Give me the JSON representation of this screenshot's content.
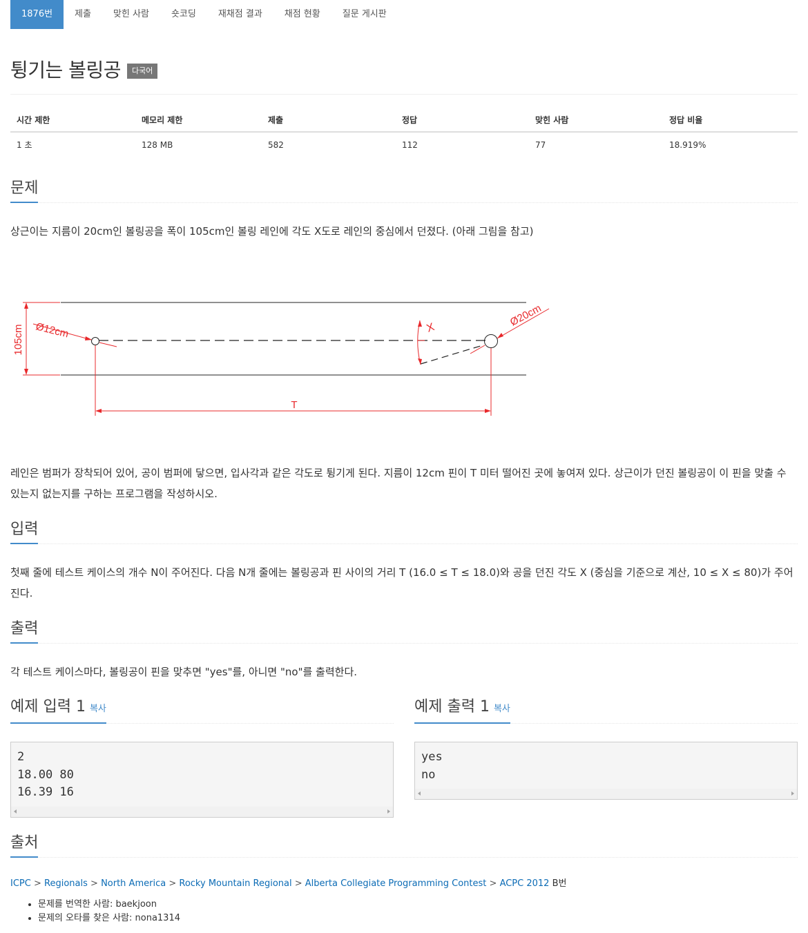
{
  "nav": {
    "tabs": [
      {
        "label": "1876번",
        "active": true
      },
      {
        "label": "제출"
      },
      {
        "label": "맞힌 사람"
      },
      {
        "label": "숏코딩"
      },
      {
        "label": "재채점 결과"
      },
      {
        "label": "채점 현황"
      },
      {
        "label": "질문 게시판"
      }
    ]
  },
  "problem": {
    "title": "튕기는 볼링공",
    "badge": "다국어"
  },
  "stats": {
    "headers": [
      "시간 제한",
      "메모리 제한",
      "제출",
      "정답",
      "맞힌 사람",
      "정답 비율"
    ],
    "values": [
      "1 초",
      "128 MB",
      "582",
      "112",
      "77",
      "18.919%"
    ]
  },
  "sections": {
    "description": {
      "heading": "문제",
      "text1": "상근이는 지름이 20cm인 볼링공을 폭이 105cm인 볼링 레인에 각도 X도로 레인의 중심에서 던졌다. (아래 그림을 참고)",
      "text2": "레인은 범퍼가 장착되어 있어, 공이 범퍼에 닿으면, 입사각과 같은 각도로 튕기게 된다. 지름이 12cm 핀이 T 미터 떨어진 곳에 놓여져 있다. 상근이가 던진 볼링공이 이 핀을 맞출 수 있는지 없는지를 구하는 프로그램을 작성하시오."
    },
    "input": {
      "heading": "입력",
      "text": "첫째 줄에 테스트 케이스의 개수 N이 주어진다. 다음 N개 줄에는 볼링공과 핀 사이의 거리 T (16.0 ≤ T ≤ 18.0)와 공을 던진 각도 X (중심을 기준으로 계산, 10 ≤ X ≤ 80)가 주어진다."
    },
    "output": {
      "heading": "출력",
      "text": "각 테스트 케이스마다, 볼링공이 핀을 맞추면 \"yes\"를, 아니면 \"no\"를 출력한다."
    },
    "sample_input": {
      "heading": "예제 입력 1",
      "copy_label": "복사",
      "lines": [
        "2",
        "18.00 80",
        "16.39 16"
      ]
    },
    "sample_output": {
      "heading": "예제 출력 1",
      "copy_label": "복사",
      "lines": [
        "yes",
        "no"
      ]
    },
    "source": {
      "heading": "출처",
      "breadcrumb": [
        "ICPC",
        "Regionals",
        "North America",
        "Rocky Mountain Regional",
        "Alberta Collegiate Programming Contest",
        "ACPC 2012"
      ],
      "suffix": "B번",
      "credits": [
        "문제를 번역한 사람: baekjoon",
        "문제의 오타를 찾은 사람: nona1314"
      ]
    }
  },
  "diagram": {
    "labels": {
      "width": "105cm",
      "pin": "Ø12cm",
      "ball": "Ø20cm",
      "angle": "X",
      "distance": "T"
    },
    "colors": {
      "dimension": "#e8282b",
      "lane": "#222222"
    }
  },
  "colors": {
    "accent": "#428bca",
    "link": "#0b6bb5",
    "badge": "#777777"
  }
}
